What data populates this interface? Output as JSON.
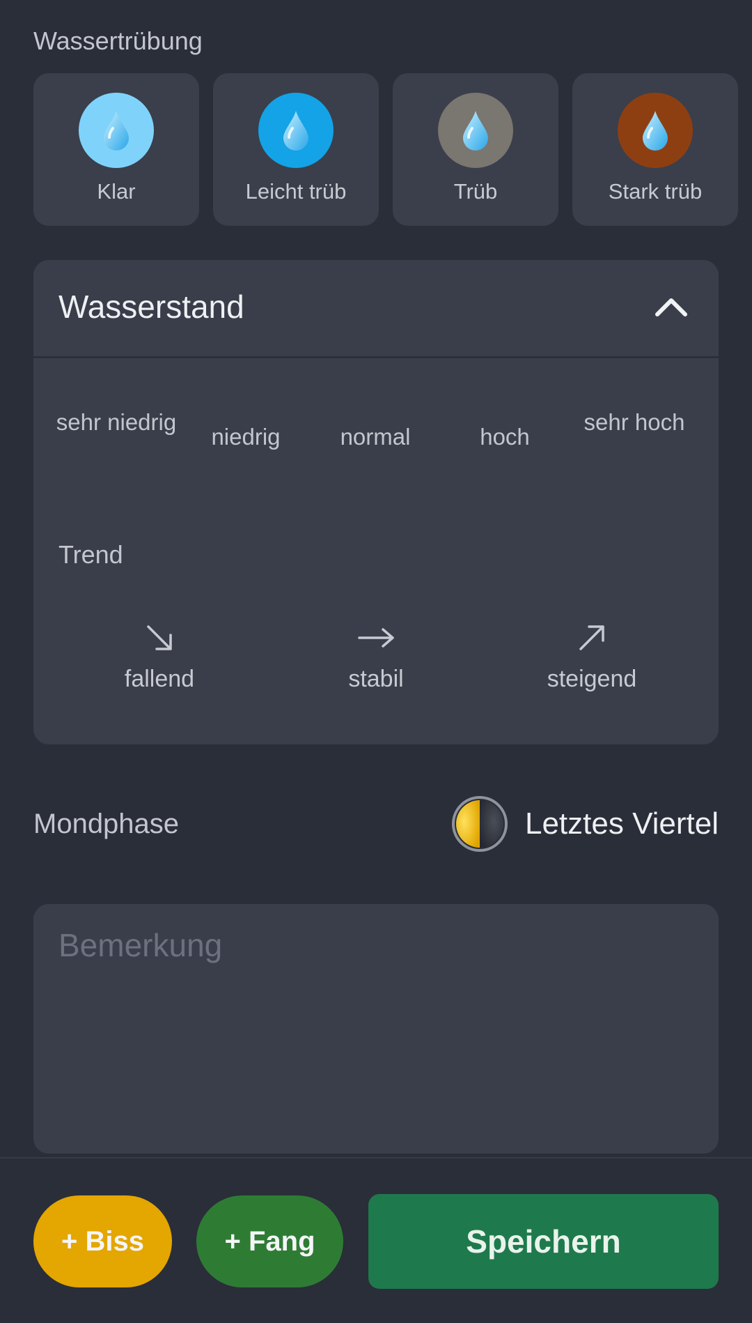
{
  "turbidity": {
    "label": "Wassertrübung",
    "options": [
      {
        "label": "Klar",
        "color": "#7fd3fb"
      },
      {
        "label": "Leicht trüb",
        "color": "#13a3e6"
      },
      {
        "label": "Trüb",
        "color": "#7a7670"
      },
      {
        "label": "Stark trüb",
        "color": "#8e3f12"
      }
    ]
  },
  "water_level": {
    "title": "Wasserstand",
    "expanded": true,
    "levels": [
      "sehr niedrig",
      "niedrig",
      "normal",
      "hoch",
      "sehr hoch"
    ],
    "trend_label": "Trend",
    "trends": [
      {
        "label": "fallend",
        "icon": "arrow-down-right-icon"
      },
      {
        "label": "stabil",
        "icon": "arrow-right-icon"
      },
      {
        "label": "steigend",
        "icon": "arrow-up-right-icon"
      }
    ]
  },
  "moon": {
    "label": "Mondphase",
    "value": "Letztes Viertel",
    "icon": "last-quarter-moon-icon"
  },
  "remark": {
    "placeholder": "Bemerkung",
    "value": ""
  },
  "actions": {
    "biss": "+ Biss",
    "fang": "+ Fang",
    "save": "Speichern",
    "colors": {
      "biss": "#e4a600",
      "fang": "#2e7c34",
      "save": "#1e7a4c"
    }
  }
}
